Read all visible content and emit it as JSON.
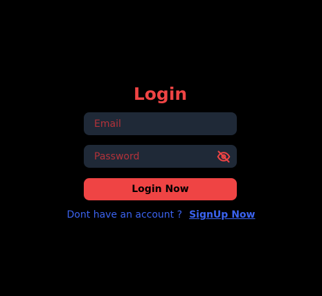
{
  "login": {
    "title": "Login",
    "email_placeholder": "Email",
    "password_placeholder": "Password",
    "submit_label": "Login Now",
    "prompt_text": "Dont have an account ?",
    "signup_label": "SignUp Now",
    "eye_icon": "eye-off-icon"
  },
  "colors": {
    "background": "#000000",
    "accent": "#ef4444",
    "input_background": "#1f2937",
    "link": "#3b63f0"
  }
}
